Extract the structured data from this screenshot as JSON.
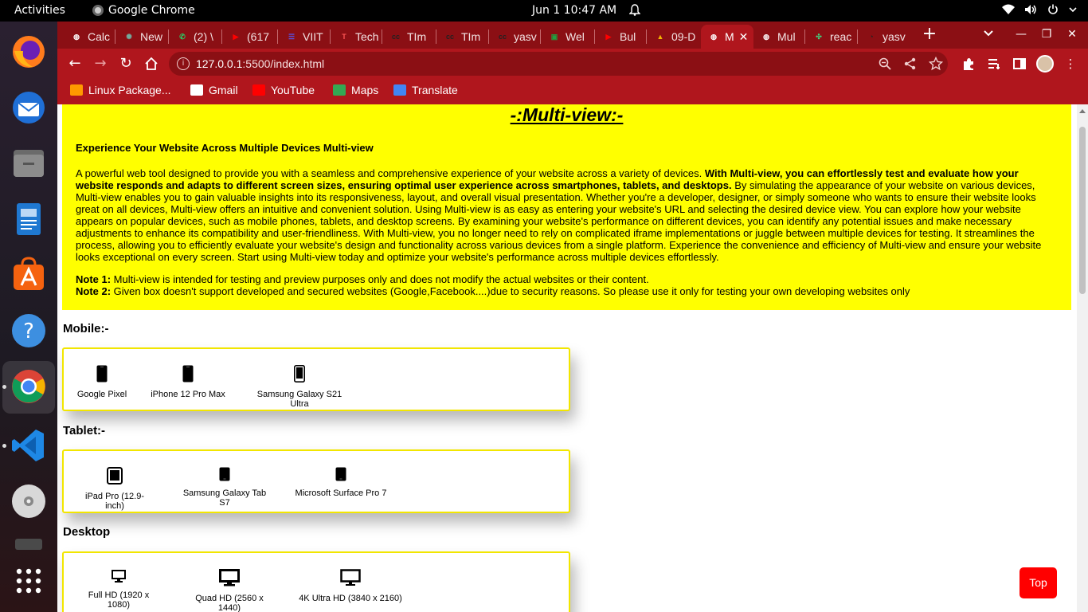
{
  "system": {
    "activities": "Activities",
    "app_name": "Google Chrome",
    "clock": "Jun 1  10:47 AM"
  },
  "tabs": [
    {
      "label": "Calc",
      "favicon": "globe-icon",
      "color": "#ffffff"
    },
    {
      "label": "New",
      "favicon": "openai-icon",
      "color": "#74aa9c"
    },
    {
      "label": "(2) \\",
      "favicon": "whatsapp-icon",
      "color": "#25d366"
    },
    {
      "label": "(617",
      "favicon": "youtube-icon",
      "color": "#ff0000"
    },
    {
      "label": "VIIT",
      "favicon": "list-icon",
      "color": "#5b4fd6"
    },
    {
      "label": "Tech",
      "favicon": "tech-icon",
      "color": "#ff5555"
    },
    {
      "label": "TIm",
      "favicon": "cc-icon",
      "color": "#222222"
    },
    {
      "label": "TIm",
      "favicon": "cc-icon",
      "color": "#222222"
    },
    {
      "label": "yasv",
      "favicon": "cc-icon",
      "color": "#222222"
    },
    {
      "label": "Wel",
      "favicon": "chat-icon",
      "color": "#20a040"
    },
    {
      "label": "Bul",
      "favicon": "youtube-icon",
      "color": "#ff0000"
    },
    {
      "label": "09-D",
      "favicon": "drive-icon",
      "color": "#f4b400"
    },
    {
      "label": "M",
      "favicon": "globe-icon",
      "color": "#ffffff",
      "active": true
    },
    {
      "label": "Mul",
      "favicon": "globe-icon",
      "color": "#ffffff"
    },
    {
      "label": "reac",
      "favicon": "replit-icon",
      "color": "#3ddc84"
    },
    {
      "label": "yasv",
      "favicon": "github-icon",
      "color": "#222222"
    }
  ],
  "address_bar": {
    "url_host": "127.0.0.1",
    "url_rest": ":5500/index.html"
  },
  "bookmarks": [
    {
      "label": "Linux Package...",
      "icon": "bolt-icon",
      "color": "#ff9900"
    },
    {
      "label": "Gmail",
      "icon": "mail-icon",
      "color": "#ffffff"
    },
    {
      "label": "YouTube",
      "icon": "youtube-icon",
      "color": "#ff0000"
    },
    {
      "label": "Maps",
      "icon": "maps-icon",
      "color": "#34a853"
    },
    {
      "label": "Translate",
      "icon": "translate-icon",
      "color": "#4285f4"
    }
  ],
  "page": {
    "title": "-:Multi-view:-",
    "heading": "Experience Your Website Across Multiple Devices Multi-view",
    "para_start": "A powerful web tool designed to provide you with a seamless and comprehensive experience of your website across a variety of devices. ",
    "para_bold": "With Multi-view, you can effortlessly test and evaluate how your website responds and adapts to different screen sizes, ensuring optimal user experience across smartphones, tablets, and desktops.",
    "para_end": " By simulating the appearance of your website on various devices, Multi-view enables you to gain valuable insights into its responsiveness, layout, and overall visual presentation. Whether you're a developer, designer, or simply someone who wants to ensure their website looks great on all devices, Multi-view offers an intuitive and convenient solution. Using Multi-view is as easy as entering your website's URL and selecting the desired device view. You can explore how your website appears on popular devices, such as mobile phones, tablets, and desktop screens. By examining your website's performance on different devices, you can identify any potential issues and make necessary adjustments to enhance its compatibility and user-friendliness. With Multi-view, you no longer need to rely on complicated iframe implementations or juggle between multiple devices for testing. It streamlines the process, allowing you to efficiently evaluate your website's design and functionality across various devices from a single platform. Experience the convenience and efficiency of Multi-view and ensure your website looks exceptional on every screen. Start using Multi-view today and optimize your website's performance across multiple devices effortlessly.",
    "note1_label": "Note 1:",
    "note1_text": " Multi-view is intended for testing and preview purposes only and does not modify the actual websites or their content.",
    "note2_label": "Note 2:",
    "note2_text": " Given box doesn't support developed and secured websites (Google,Facebook....)due to security reasons. So please use it only for testing your own developing websites only",
    "mobile_title": "Mobile:-",
    "mobile_devices": [
      "Google Pixel",
      "iPhone 12 Pro Max",
      "Samsung Galaxy S21 Ultra"
    ],
    "tablet_title": "Tablet:-",
    "tablet_devices": [
      "iPad Pro (12.9-inch)",
      "Samsung Galaxy Tab S7",
      "Microsoft Surface Pro 7"
    ],
    "desktop_title": "Desktop",
    "desktop_devices": [
      "Full HD (1920 x 1080)",
      "Quad HD (2560 x 1440)",
      "4K Ultra HD (3840 x 2160)"
    ],
    "top_button": "Top"
  },
  "colors": {
    "hero_bg": "#ffff00",
    "browser_theme": "#b0161d",
    "top_button": "#ff0000"
  }
}
